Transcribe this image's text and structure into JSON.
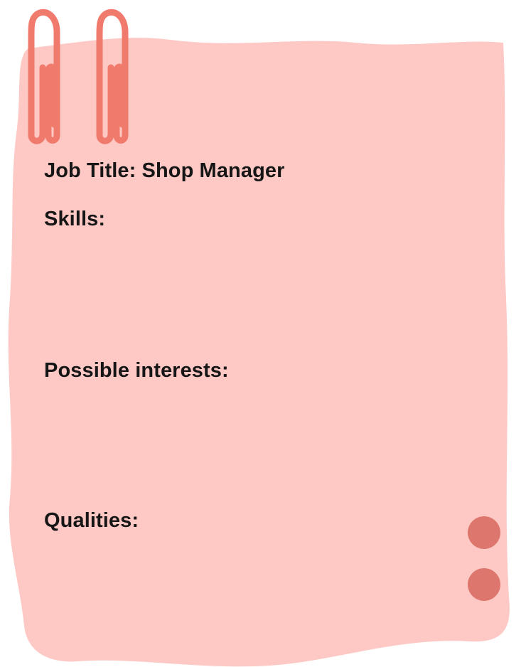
{
  "card": {
    "job_title": "Job Title: Shop Manager",
    "skills_heading": "Skills:",
    "interests_heading": "Possible interests:",
    "qualities_heading": "Qualities:"
  },
  "colors": {
    "paper": "#fec9c5",
    "clip": "#f07a6c",
    "dot": "#dd776d",
    "text": "#161616"
  },
  "decorations": {
    "clip_icon": "paper-clip-icon",
    "dot_icon": "circle-dot-icon"
  }
}
